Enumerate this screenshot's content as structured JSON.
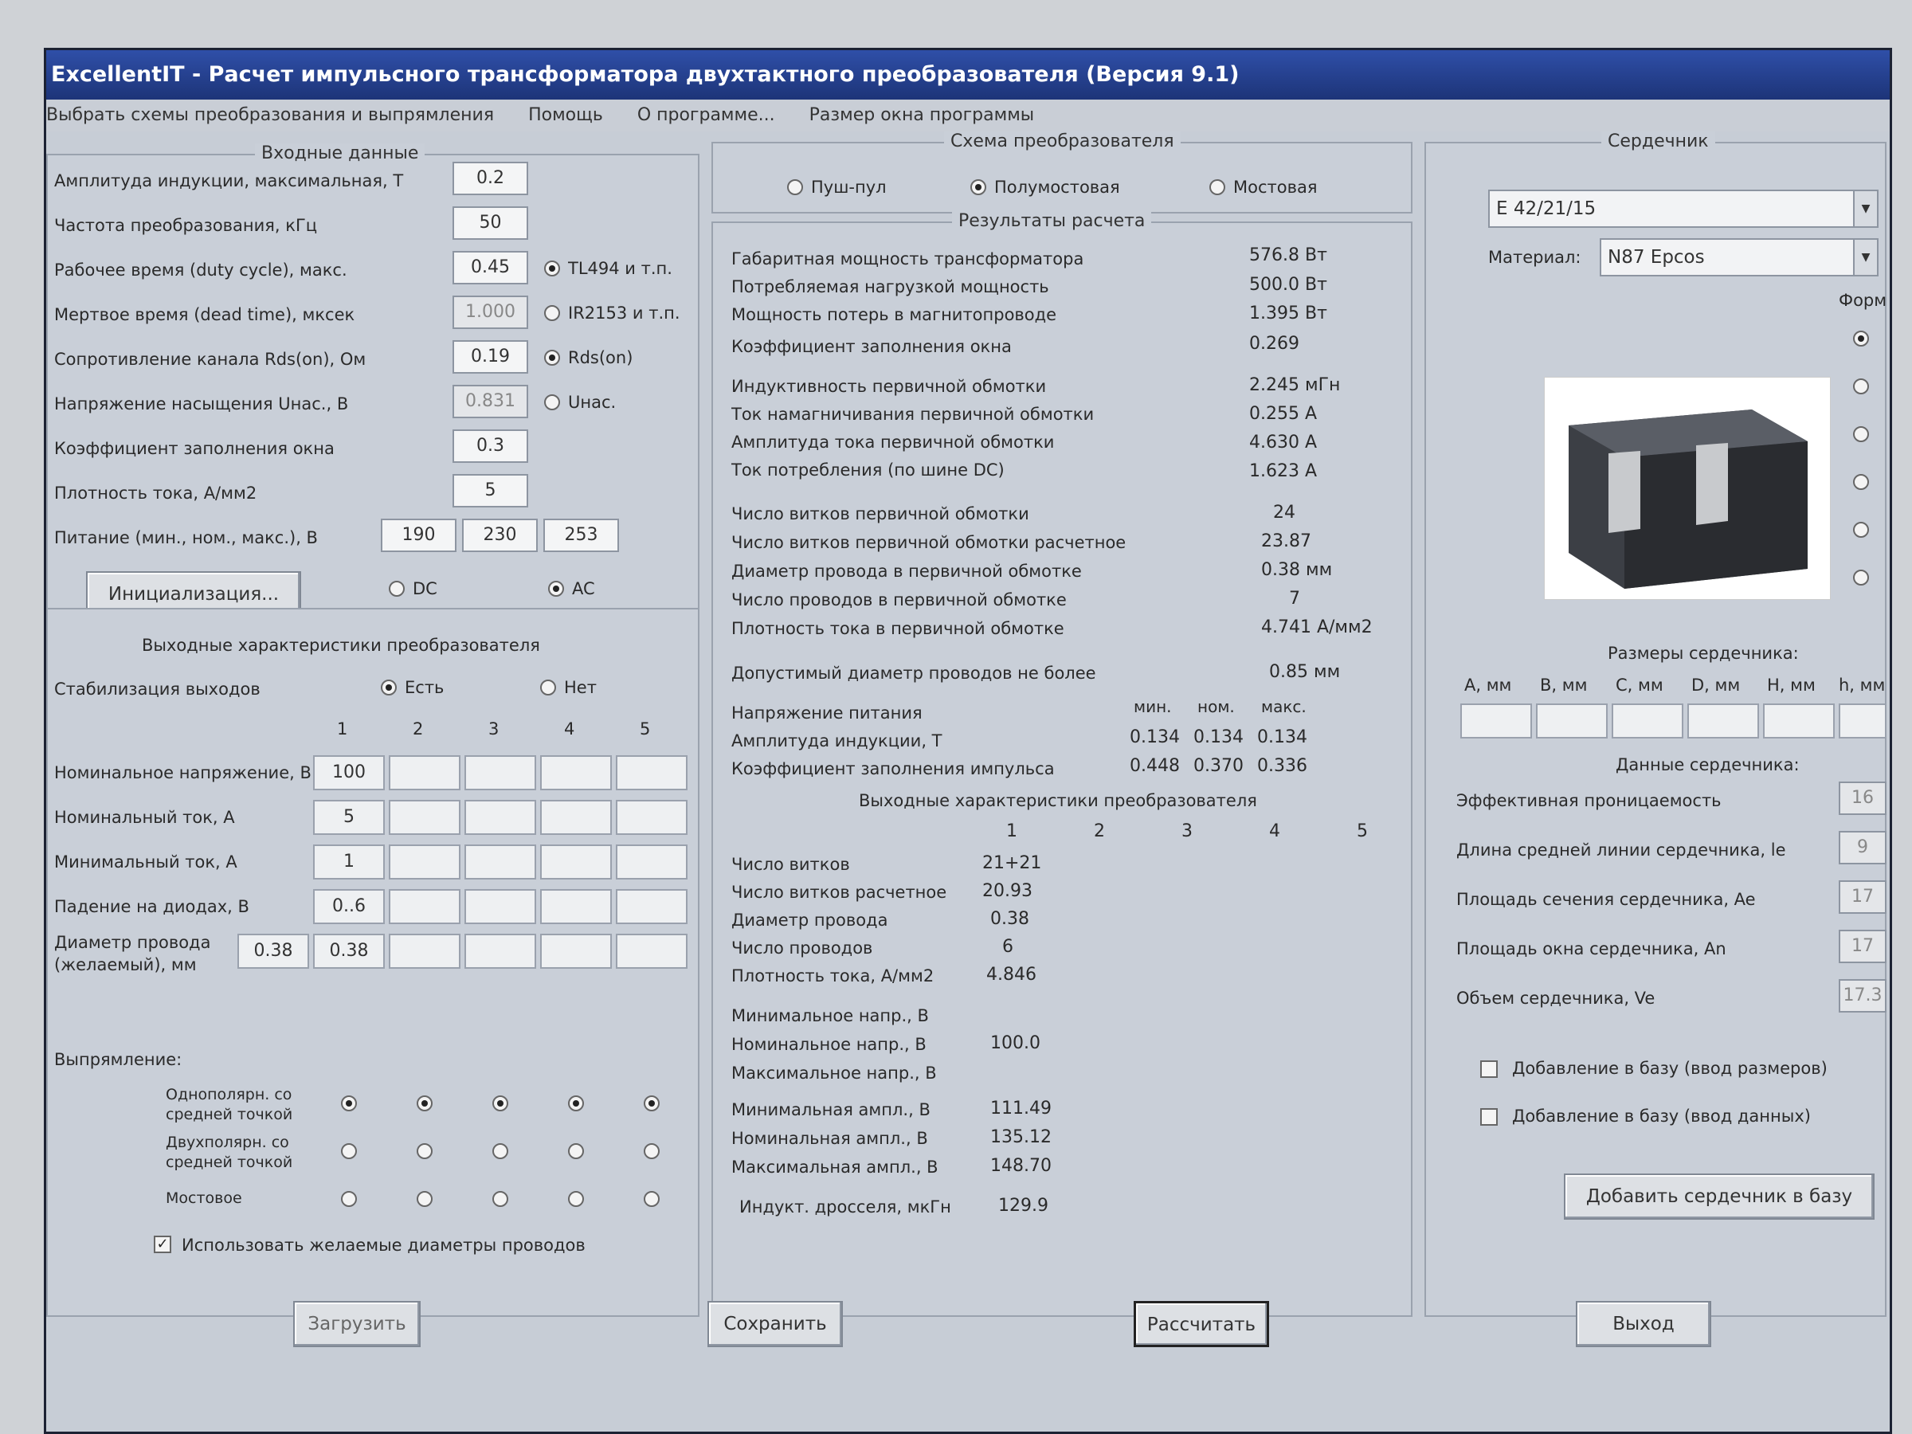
{
  "window": {
    "title": "ExcellentIT - Расчет импульсного трансформатора двухтактного преобразователя (Версия 9.1)",
    "menu": [
      "Выбрать схемы преобразования и выпрямления",
      "Помощь",
      "О программе...",
      "Размер окна программы"
    ]
  },
  "input": {
    "legend": "Входные данные",
    "rows": [
      {
        "label": "Амплитуда индукции, максимальная, Т",
        "value": "0.2"
      },
      {
        "label": "Частота преобразования, кГц",
        "value": "50"
      },
      {
        "label": "Рабочее время (duty cycle), макс.",
        "value": "0.45"
      },
      {
        "label": "Мертвое время (dead time), мксек",
        "value": "1.000"
      },
      {
        "label": "Сопротивление канала Rds(on), Ом",
        "value": "0.19"
      },
      {
        "label": "Напряжение насыщения Uнас., В",
        "value": "0.831"
      },
      {
        "label": "Коэффициент заполнения окна",
        "value": "0.3"
      },
      {
        "label": "Плотность тока, А/мм2",
        "value": "5"
      }
    ],
    "supply_label": "Питание (мин., ном., макс.), В",
    "supply": [
      "190",
      "230",
      "253"
    ],
    "radio_tl494": "TL494 и т.п.",
    "radio_ir2153": "IR2153 и т.п.",
    "radio_rds": "Rds(on)",
    "radio_unas": "Uнас.",
    "radio_dc": "DC",
    "radio_ac": "AC",
    "init_button": "Инициализация..."
  },
  "outputs": {
    "title": "Выходные характеристики преобразователя",
    "stab_label": "Стабилизация выходов",
    "stab_yes": "Есть",
    "stab_no": "Нет",
    "cols": [
      "1",
      "2",
      "3",
      "4",
      "5"
    ],
    "rows": [
      {
        "label": "Номинальное напряжение, В",
        "values": [
          "100",
          "",
          "",
          "",
          ""
        ]
      },
      {
        "label": "Номинальный ток, А",
        "values": [
          "5",
          "",
          "",
          "",
          ""
        ]
      },
      {
        "label": "Минимальный ток, А",
        "values": [
          "1",
          "",
          "",
          "",
          ""
        ]
      },
      {
        "label": "Падение на диодах, В",
        "values": [
          "0..6",
          "",
          "",
          "",
          ""
        ]
      }
    ],
    "wire_label_1": "Диаметр провода",
    "wire_label_2": "(желаемый), мм",
    "wire_extra": "0.38",
    "wire_values": [
      "0.38",
      "",
      "",
      "",
      ""
    ],
    "rect_label": "Выпрямление:",
    "rect_opt1a": "Однополярн. со",
    "rect_opt1b": "средней точкой",
    "rect_opt2a": "Двухполярн. со",
    "rect_opt2b": "средней точкой",
    "rect_opt3": "Мостовое",
    "use_wire_check": "Использовать желаемые диаметры проводов"
  },
  "scheme": {
    "legend": "Схема преобразователя",
    "opt_pushpull": "Пуш-пул",
    "opt_half": "Полумостовая",
    "opt_bridge": "Мостовая"
  },
  "results": {
    "legend": "Результаты расчета",
    "g1": [
      {
        "label": "Габаритная мощность трансформатора",
        "value": "576.8 Вт"
      },
      {
        "label": "Потребляемая нагрузкой мощность",
        "value": "500.0 Вт"
      },
      {
        "label": "Мощность потерь в магнитопроводе",
        "value": "1.395 Вт"
      },
      {
        "label": "Коэффициент заполнения окна",
        "value": "0.269"
      }
    ],
    "g2": [
      {
        "label": "Индуктивность первичной обмотки",
        "value": "2.245 мГн"
      },
      {
        "label": "Ток намагничивания первичной обмотки",
        "value": "0.255 А"
      },
      {
        "label": "Амплитуда тока первичной обмотки",
        "value": "4.630 А"
      },
      {
        "label": "Ток потребления (по шине DC)",
        "value": "1.623 А"
      }
    ],
    "g3": [
      {
        "label": "Число витков первичной обмотки",
        "value": "24"
      },
      {
        "label": "Число витков первичной обмотки расчетное",
        "value": "23.87"
      },
      {
        "label": "Диаметр провода в первичной обмотке",
        "value": "0.38 мм"
      },
      {
        "label": "Число проводов в первичной обмотке",
        "value": "7"
      },
      {
        "label": "Плотность тока в первичной обмотке",
        "value": "4.741 А/мм2"
      }
    ],
    "allowed_label": "Допустимый диаметр проводов не более",
    "allowed_value": "0.85 мм",
    "supply_header": [
      "мин.",
      "ном.",
      "макс."
    ],
    "supply_label": "Напряжение питания",
    "induction_label": "Амплитуда индукции, Т",
    "induction": [
      "0.134",
      "0.134",
      "0.134"
    ],
    "fill_label": "Коэффициент заполнения импульса",
    "fill": [
      "0.448",
      "0.370",
      "0.336"
    ],
    "out_title": "Выходные характеристики преобразователя",
    "out_cols": [
      "1",
      "2",
      "3",
      "4",
      "5"
    ],
    "out_rows": [
      {
        "label": "Число витков",
        "value": "21+21"
      },
      {
        "label": "Число витков расчетное",
        "value": "20.93"
      },
      {
        "label": "Диаметр провода",
        "value": "0.38"
      },
      {
        "label": "Число проводов",
        "value": "6"
      },
      {
        "label": "Плотность тока, А/мм2",
        "value": "4.846"
      }
    ],
    "volt_rows": [
      {
        "label": "Минимальное напр., В",
        "value": ""
      },
      {
        "label": "Номинальное напр., В",
        "value": "100.0"
      },
      {
        "label": "Максимальное напр., В",
        "value": ""
      }
    ],
    "ampl_rows": [
      {
        "label": "Минимальная ампл., В",
        "value": "111.49"
      },
      {
        "label": "Номинальная ампл., В",
        "value": "135.12"
      },
      {
        "label": "Максимальная ампл., В",
        "value": "148.70"
      }
    ],
    "choke_label": "Индукт. дросселя, мкГн",
    "choke_value": "129.9"
  },
  "core": {
    "legend": "Сердечник",
    "selected": "E 42/21/15",
    "material_label": "Материал:",
    "material": "N87 Epcos",
    "form_label": "Форма",
    "dims_title": "Размеры сердечника:",
    "dims": [
      "A, мм",
      "B, мм",
      "C, мм",
      "D, мм",
      "H, мм",
      "h, мм"
    ],
    "data_title": "Данные сердечника:",
    "data_rows": [
      {
        "label": "Эффективная проницаемость",
        "value": "16"
      },
      {
        "label": "Длина средней линии сердечника, le",
        "value": "9"
      },
      {
        "label": "Площадь сечения сердечника, Ae",
        "value": "17"
      },
      {
        "label": "Площадь окна сердечника, An",
        "value": "17"
      },
      {
        "label": "Объем сердечника, Ve",
        "value": "17.3"
      }
    ],
    "add_dims": "Добавление в базу (ввод размеров)",
    "add_data": "Добавление в базу (ввод данных)",
    "add_button": "Добавить сердечник в базу"
  },
  "buttons": {
    "load": "Загрузить",
    "save": "Сохранить",
    "calc": "Рассчитать",
    "exit": "Выход"
  }
}
